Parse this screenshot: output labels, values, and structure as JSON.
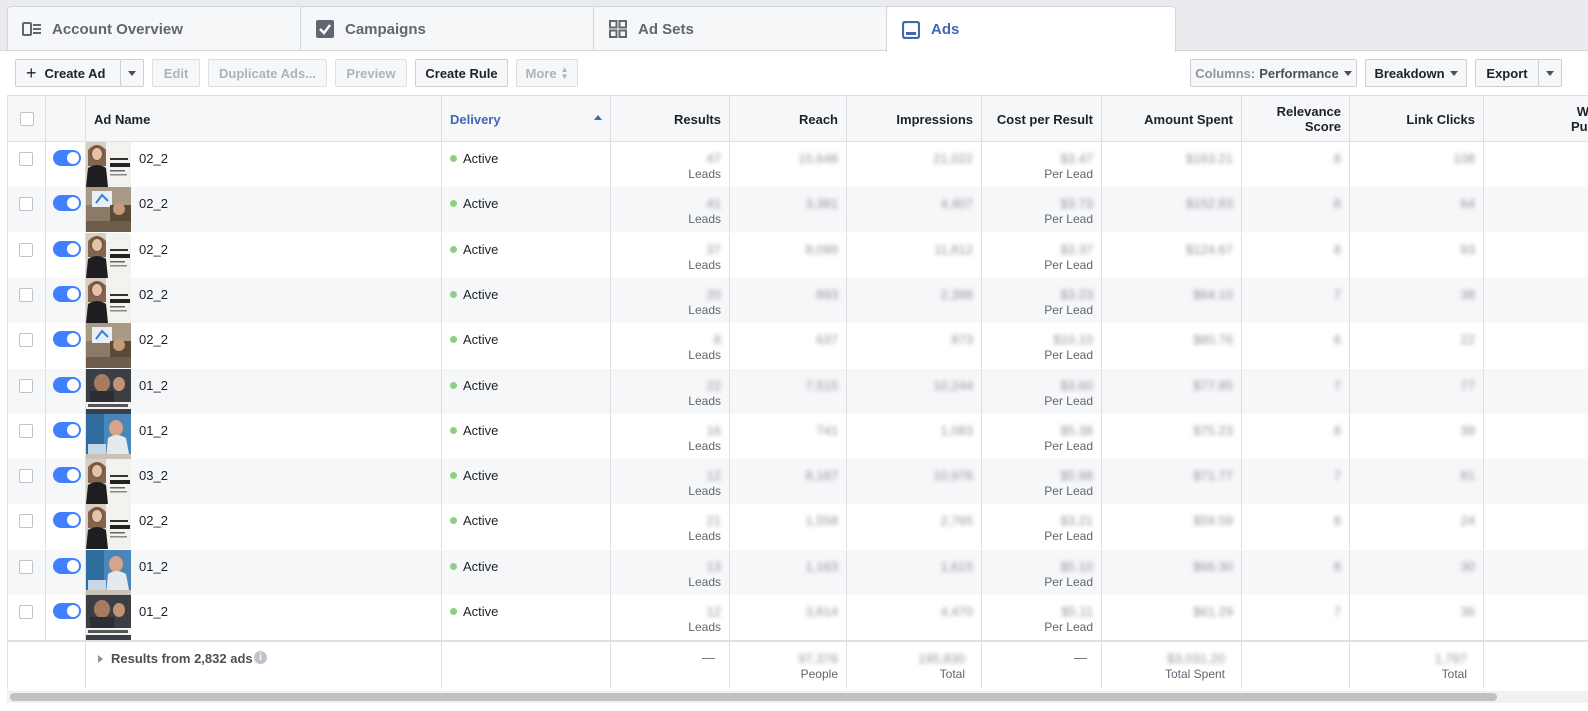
{
  "tabs": [
    {
      "label": "Account Overview",
      "icon": "account-overview-icon"
    },
    {
      "label": "Campaigns",
      "icon": "checkbox-icon"
    },
    {
      "label": "Ad Sets",
      "icon": "grid-icon"
    },
    {
      "label": "Ads",
      "icon": "ad-icon"
    }
  ],
  "active_tab": "Ads",
  "toolbar": {
    "create_ad": "Create Ad",
    "edit": "Edit",
    "duplicate": "Duplicate Ads...",
    "preview": "Preview",
    "create_rule": "Create Rule",
    "more": "More",
    "columns_prefix": "Columns:",
    "columns_value": "Performance",
    "breakdown": "Breakdown",
    "export": "Export"
  },
  "columns": {
    "ad_name": "Ad Name",
    "delivery": "Delivery",
    "results": "Results",
    "reach": "Reach",
    "impressions": "Impressions",
    "cost_per_result": "Cost per Result",
    "amount_spent": "Amount Spent",
    "relevance_line1": "Relevance",
    "relevance_line2": "Score",
    "link_clicks": "Link Clicks",
    "next_line1": "W",
    "next_line2": "Pur"
  },
  "colors": {
    "accent": "#4267b2",
    "toggle": "#4080ff",
    "active_dot": "#8fcf84"
  },
  "rows": [
    {
      "name": "02_2",
      "thumb": "woman-book",
      "status": "Active",
      "results": "47",
      "results_unit": "Leads",
      "reach": "15,648",
      "impressions": "21,022",
      "cpr": "$3.47",
      "cpr_unit": "Per Lead",
      "spent": "$163.21",
      "relevance": "8",
      "clicks": "108"
    },
    {
      "name": "02_2",
      "thumb": "office",
      "status": "Active",
      "results": "41",
      "results_unit": "Leads",
      "reach": "3,381",
      "impressions": "4,407",
      "cpr": "$3.73",
      "cpr_unit": "Per Lead",
      "spent": "$152.83",
      "relevance": "8",
      "clicks": "64"
    },
    {
      "name": "02_2",
      "thumb": "woman-book",
      "status": "Active",
      "results": "37",
      "results_unit": "Leads",
      "reach": "8,099",
      "impressions": "11,812",
      "cpr": "$3.37",
      "cpr_unit": "Per Lead",
      "spent": "$124.67",
      "relevance": "8",
      "clicks": "93"
    },
    {
      "name": "02_2",
      "thumb": "woman-book",
      "status": "Active",
      "results": "20",
      "results_unit": "Leads",
      "reach": "893",
      "impressions": "2,398",
      "cpr": "$3.23",
      "cpr_unit": "Per Lead",
      "spent": "$64.10",
      "relevance": "7",
      "clicks": "38"
    },
    {
      "name": "02_2",
      "thumb": "office",
      "status": "Active",
      "results": "8",
      "results_unit": "Leads",
      "reach": "637",
      "impressions": "873",
      "cpr": "$10.10",
      "cpr_unit": "Per Lead",
      "spent": "$80.76",
      "relevance": "6",
      "clicks": "22"
    },
    {
      "name": "01_2",
      "thumb": "agency-dark",
      "status": "Active",
      "results": "22",
      "results_unit": "Leads",
      "reach": "7,515",
      "impressions": "10,244",
      "cpr": "$3.60",
      "cpr_unit": "Per Lead",
      "spent": "$77.85",
      "relevance": "7",
      "clicks": "77"
    },
    {
      "name": "01_2",
      "thumb": "blue-desk",
      "status": "Active",
      "results": "16",
      "results_unit": "Leads",
      "reach": "741",
      "impressions": "1,083",
      "cpr": "$5.38",
      "cpr_unit": "Per Lead",
      "spent": "$75.23",
      "relevance": "8",
      "clicks": "39"
    },
    {
      "name": "03_2",
      "thumb": "woman-book",
      "status": "Active",
      "results": "12",
      "results_unit": "Leads",
      "reach": "8,187",
      "impressions": "10,976",
      "cpr": "$5.98",
      "cpr_unit": "Per Lead",
      "spent": "$71.77",
      "relevance": "7",
      "clicks": "81"
    },
    {
      "name": "02_2",
      "thumb": "woman-book",
      "status": "Active",
      "results": "21",
      "results_unit": "Leads",
      "reach": "1,558",
      "impressions": "2,765",
      "cpr": "$3.21",
      "cpr_unit": "Per Lead",
      "spent": "$59.59",
      "relevance": "8",
      "clicks": "24"
    },
    {
      "name": "01_2",
      "thumb": "blue-desk",
      "status": "Active",
      "results": "13",
      "results_unit": "Leads",
      "reach": "1,163",
      "impressions": "1,615",
      "cpr": "$5.10",
      "cpr_unit": "Per Lead",
      "spent": "$66.30",
      "relevance": "8",
      "clicks": "30"
    },
    {
      "name": "01_2",
      "thumb": "agency-dark",
      "status": "Active",
      "results": "12",
      "results_unit": "Leads",
      "reach": "3,814",
      "impressions": "4,470",
      "cpr": "$5.11",
      "cpr_unit": "Per Lead",
      "spent": "$61.29",
      "relevance": "7",
      "clicks": "36"
    }
  ],
  "footer": {
    "label": "Results from 2,832 ads",
    "results": "—",
    "reach": "97,376",
    "reach_unit": "People",
    "impressions": "195,830",
    "impressions_unit": "Total",
    "cpr": "—",
    "spent": "$3,031.20",
    "spent_unit": "Total Spent",
    "clicks": "1,797",
    "clicks_unit": "Total"
  }
}
